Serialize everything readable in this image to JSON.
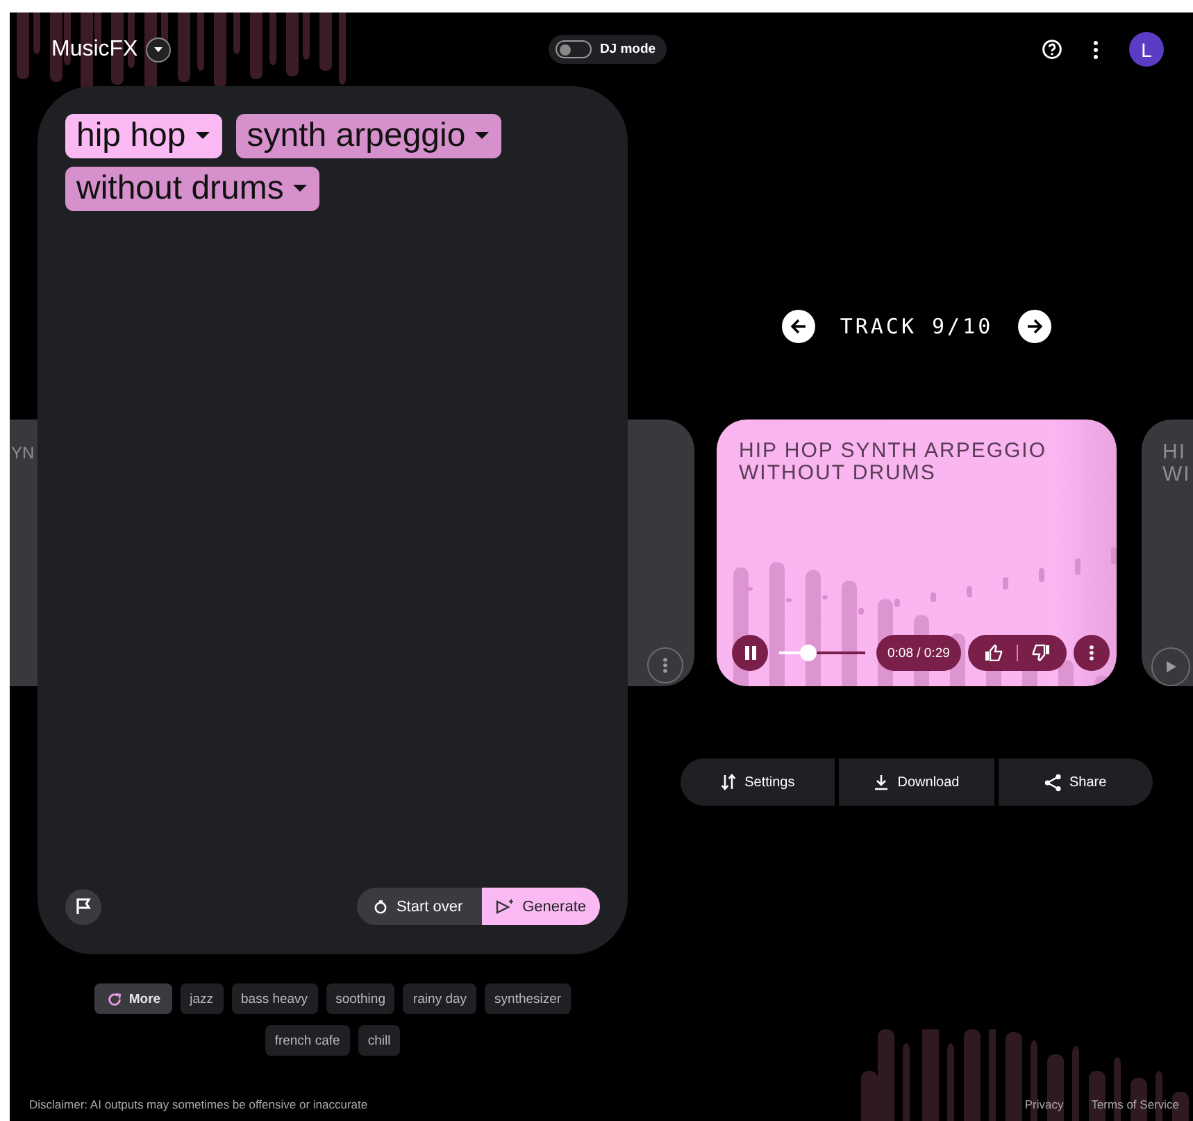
{
  "app": {
    "title": "MusicFX"
  },
  "dj_mode": {
    "label": "DJ mode",
    "on": false
  },
  "avatar": {
    "letter": "L"
  },
  "prompt": {
    "chips": [
      {
        "label": "hip hop",
        "color": "#fbb9f3"
      },
      {
        "label": "synth arpeggio",
        "color": "#d690cc"
      },
      {
        "label": "without drums",
        "color": "#d690cc"
      }
    ]
  },
  "prompt_actions": [
    {
      "kind": "reset",
      "label": "Start over"
    },
    {
      "kind": "generate",
      "label": "Generate"
    }
  ],
  "suggestions": [
    {
      "kind": "more",
      "label": "More"
    },
    {
      "kind": "tag",
      "label": "jazz"
    },
    {
      "kind": "tag",
      "label": "bass heavy"
    },
    {
      "kind": "tag",
      "label": "soothing"
    },
    {
      "kind": "tag",
      "label": "rainy day"
    },
    {
      "kind": "tag",
      "label": "synthesizer"
    },
    {
      "kind": "tag",
      "label": "french cafe"
    },
    {
      "kind": "tag",
      "label": "chill"
    }
  ],
  "track_nav": {
    "label": "TRACK 9/10"
  },
  "tracks": [
    {
      "kind": "side",
      "title_lines": [
        "YN"
      ]
    },
    {
      "kind": "current",
      "title": "HIP HOP SYNTH ARPEGGIO WITHOUT DRUMS",
      "playing": true,
      "level": 0.3,
      "time": "0:08 / 0:29"
    },
    {
      "kind": "side",
      "title_lines": [
        "HI",
        "WI"
      ]
    }
  ],
  "actions": [
    {
      "kind": "settings",
      "label": "Settings"
    },
    {
      "kind": "download",
      "label": "Download"
    },
    {
      "kind": "share",
      "label": "Share"
    }
  ],
  "footer": {
    "disclaimer": "Disclaimer: AI outputs may sometimes be offensive or inaccurate",
    "links": [
      "Privacy",
      "Terms of Service"
    ]
  }
}
